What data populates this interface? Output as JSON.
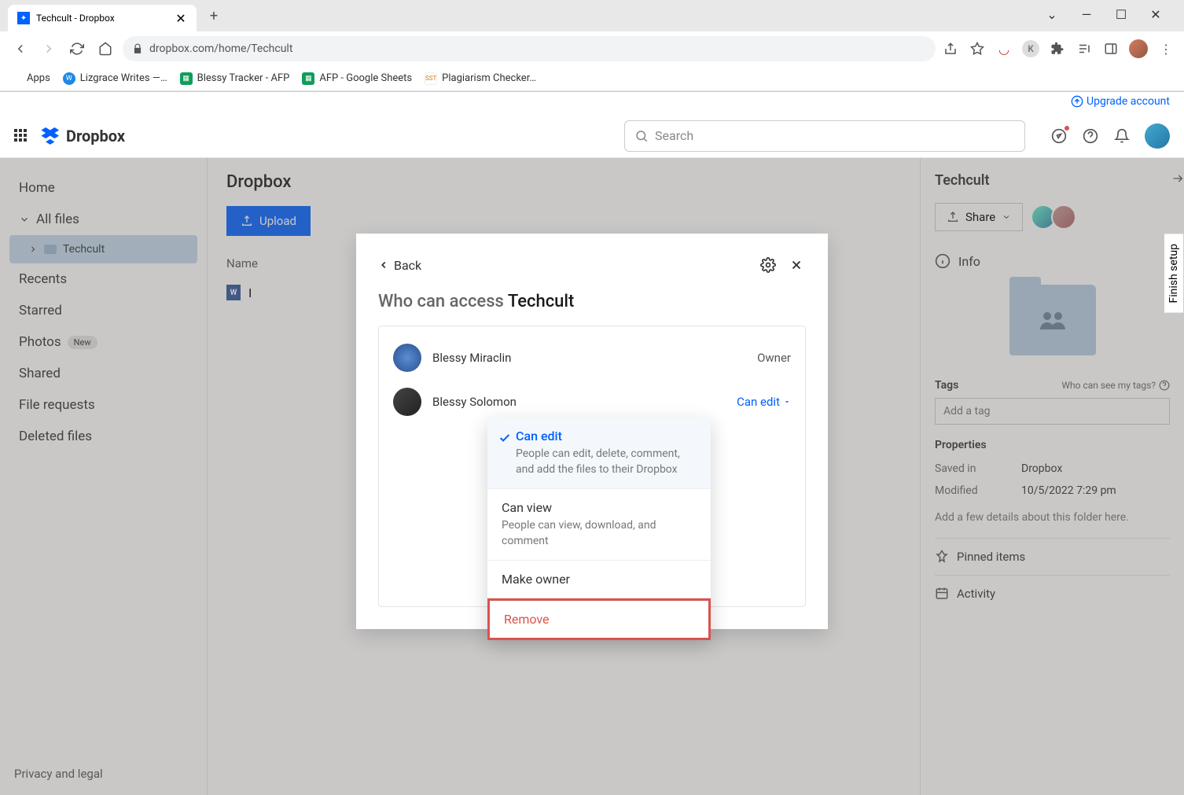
{
  "browser": {
    "tab_title": "Techcult - Dropbox",
    "url": "dropbox.com/home/Techcult",
    "bookmarks": [
      {
        "label": "Apps",
        "color": "#d93025"
      },
      {
        "label": "Lizgrace Writes —…",
        "color": "#1e88e5"
      },
      {
        "label": "Blessy Tracker - AFP",
        "color": "#0f9d58"
      },
      {
        "label": "AFP - Google Sheets",
        "color": "#0f9d58"
      },
      {
        "label": "Plagiarism Checker…",
        "color": "#d97706"
      }
    ]
  },
  "header": {
    "upgrade": "Upgrade account",
    "logo": "Dropbox",
    "search_placeholder": "Search"
  },
  "sidebar": {
    "items": [
      "Home",
      "All files",
      "Recents",
      "Starred",
      "Photos",
      "Shared",
      "File requests",
      "Deleted files"
    ],
    "subfolder": "Techcult",
    "new_pill": "New",
    "footer": "Privacy and legal"
  },
  "main": {
    "title": "Dropbox",
    "upload": "Upload",
    "col_name": "Name",
    "row_prefix": "I"
  },
  "details": {
    "title": "Techcult",
    "share": "Share",
    "info": "Info",
    "tags": "Tags",
    "tags_hint": "Who can see my tags?",
    "tag_placeholder": "Add a tag",
    "properties": "Properties",
    "saved_in_k": "Saved in",
    "saved_in_v": "Dropbox",
    "modified_k": "Modified",
    "modified_v": "10/5/2022 7:29 pm",
    "details_hint": "Add a few details about this folder here.",
    "pinned": "Pinned items",
    "activity": "Activity",
    "finish_setup": "Finish setup"
  },
  "modal": {
    "back": "Back",
    "prefix": "Who can access ",
    "folder": "Techcult",
    "people": [
      {
        "name": "Blessy Miraclin",
        "role": "Owner"
      },
      {
        "name": "Blessy Solomon",
        "perm": "Can edit"
      }
    ]
  },
  "popover": {
    "can_edit": "Can edit",
    "can_edit_desc": "People can edit, delete, comment, and add the files to their Dropbox",
    "can_view": "Can view",
    "can_view_desc": "People can view, download, and comment",
    "make_owner": "Make owner",
    "remove": "Remove"
  }
}
